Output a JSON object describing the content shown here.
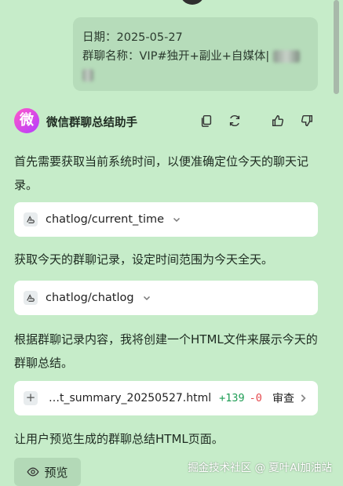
{
  "user_message": {
    "date_line": "日期：2025-05-27",
    "group_line": "群聊名称：VIP#独开+副业+自媒体|"
  },
  "assistant": {
    "logo_char": "微",
    "name": "微信群聊总结助手",
    "actions": [
      "copy-icon",
      "refresh-icon",
      "thumbs-up-icon",
      "thumbs-down-icon"
    ]
  },
  "content": {
    "para1": "首先需要获取当前系统时间，以便准确定位今天的聊天记录。",
    "tool1": "chatlog/current_time",
    "para2": "获取今天的群聊记录，设定时间范围为今天全天。",
    "tool2": "chatlog/chatlog",
    "para3": "根据群聊记录内容，我将创建一个HTML文件来展示今天的群聊总结。",
    "file": {
      "name": "…t_summary_20250527.html",
      "additions": "+139",
      "deletions": "-0",
      "review_label": "审查"
    },
    "para4": "让用户预览生成的群聊总结HTML页面。",
    "preview_label": "预览"
  },
  "watermark": "掘金技术社区 @ 夏叶AI加油站"
}
